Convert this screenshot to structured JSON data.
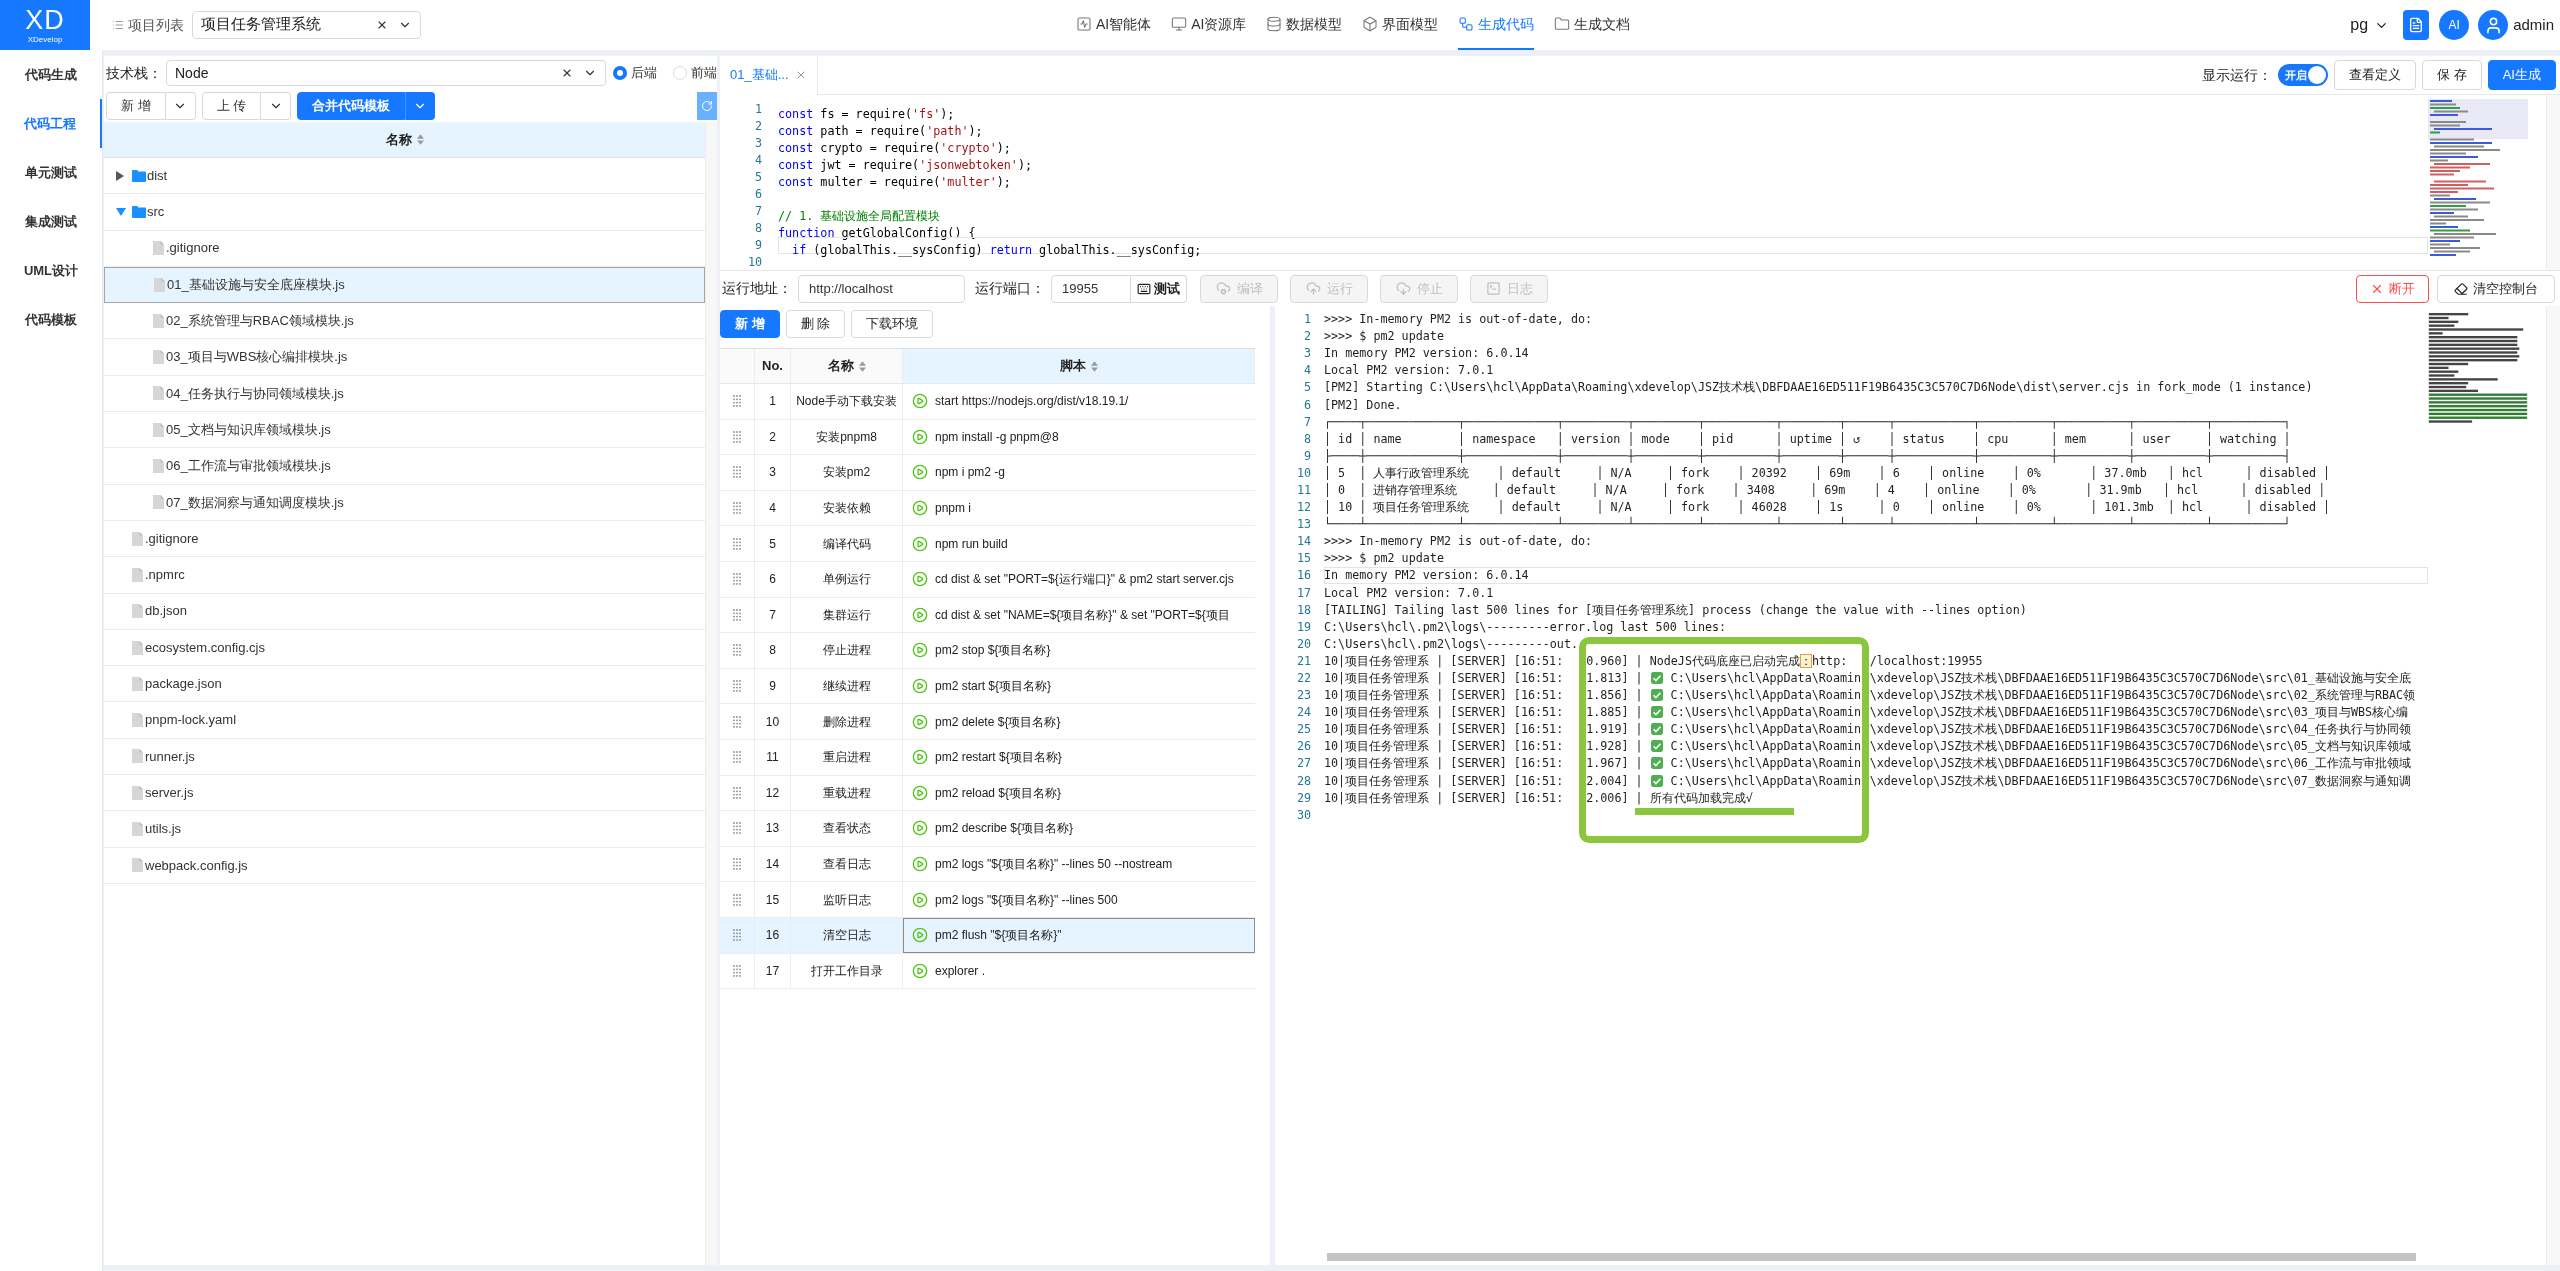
{
  "header": {
    "logo": {
      "mark": "XD",
      "name": "XDevelop"
    },
    "project_list": "项目列表",
    "project_select": {
      "value": "项目任务管理系统"
    },
    "nav": [
      {
        "label": "AI智能体",
        "selected": false
      },
      {
        "label": "AI资源库",
        "selected": false
      },
      {
        "label": "数据模型",
        "selected": false
      },
      {
        "label": "界面模型",
        "selected": false
      },
      {
        "label": "生成代码",
        "selected": true
      },
      {
        "label": "生成文档",
        "selected": false
      }
    ],
    "db_select": {
      "value": "pg"
    },
    "ai_button": "AI",
    "user": "admin"
  },
  "sidebar": {
    "items": [
      {
        "label": "代码生成",
        "selected": false
      },
      {
        "label": "代码工程",
        "selected": true
      },
      {
        "label": "单元测试",
        "selected": false
      },
      {
        "label": "集成测试",
        "selected": false
      },
      {
        "label": "UML设计",
        "selected": false
      },
      {
        "label": "代码模板",
        "selected": false
      }
    ]
  },
  "file_panel": {
    "tech_stack": {
      "label": "技术栈：",
      "value": "Node"
    },
    "side_options": [
      {
        "label": "后端",
        "selected": true
      },
      {
        "label": "前端",
        "selected": false
      }
    ],
    "buttons": [
      {
        "label": "新 增",
        "kind": "default"
      },
      {
        "label": "上 传",
        "kind": "default"
      },
      {
        "label": "合并代码模板",
        "kind": "primary"
      }
    ],
    "tree": {
      "column": {
        "label": "名称",
        "sortable": true
      },
      "items": [
        {
          "name": "dist",
          "kind": "folder",
          "expanded": false,
          "selected": false
        },
        {
          "name": "src",
          "kind": "folder",
          "expanded": true,
          "selected": false,
          "children": [
            {
              "name": ".gitignore",
              "kind": "file",
              "selected": false
            },
            {
              "name": "01_基础设施与安全底座模块.js",
              "kind": "file",
              "selected": true
            },
            {
              "name": "02_系统管理与RBAC领域模块.js",
              "kind": "file",
              "selected": false
            },
            {
              "name": "03_项目与WBS核心编排模块.js",
              "kind": "file",
              "selected": false
            },
            {
              "name": "04_任务执行与协同领域模块.js",
              "kind": "file",
              "selected": false
            },
            {
              "name": "05_文档与知识库领域模块.js",
              "kind": "file",
              "selected": false
            },
            {
              "name": "06_工作流与审批领域模块.js",
              "kind": "file",
              "selected": false
            },
            {
              "name": "07_数据洞察与通知调度模块.js",
              "kind": "file",
              "selected": false
            }
          ]
        },
        {
          "name": ".gitignore",
          "kind": "file",
          "selected": false
        },
        {
          "name": ".npmrc",
          "kind": "file",
          "selected": false
        },
        {
          "name": "db.json",
          "kind": "file",
          "selected": false
        },
        {
          "name": "ecosystem.config.cjs",
          "kind": "file",
          "selected": false
        },
        {
          "name": "package.json",
          "kind": "file",
          "selected": false
        },
        {
          "name": "pnpm-lock.yaml",
          "kind": "file",
          "selected": false
        },
        {
          "name": "runner.js",
          "kind": "file",
          "selected": false
        },
        {
          "name": "server.js",
          "kind": "file",
          "selected": false
        },
        {
          "name": "utils.js",
          "kind": "file",
          "selected": false
        },
        {
          "name": "webpack.config.js",
          "kind": "file",
          "selected": false
        }
      ]
    }
  },
  "editor": {
    "tabs": [
      {
        "label": "01_基础...",
        "selected": true
      }
    ],
    "show_run": {
      "label": "显示运行：",
      "on": true,
      "on_text": "开启"
    },
    "buttons": [
      {
        "label": "查看定义",
        "kind": "default"
      },
      {
        "label": "保 存",
        "kind": "default"
      },
      {
        "label": "AI生成",
        "kind": "primary"
      }
    ],
    "lines": [
      {
        "number": "1",
        "current": false,
        "tokens": [
          {
            "text": "const",
            "kind": "keyword"
          },
          {
            "text": " fs = require(",
            "kind": "plain"
          },
          {
            "text": "'fs'",
            "kind": "string"
          },
          {
            "text": ");",
            "kind": "plain"
          }
        ]
      },
      {
        "number": "2",
        "current": false,
        "tokens": [
          {
            "text": "const",
            "kind": "keyword"
          },
          {
            "text": " path = require(",
            "kind": "plain"
          },
          {
            "text": "'path'",
            "kind": "string"
          },
          {
            "text": ");",
            "kind": "plain"
          }
        ]
      },
      {
        "number": "3",
        "current": false,
        "tokens": [
          {
            "text": "const",
            "kind": "keyword"
          },
          {
            "text": " crypto = require(",
            "kind": "plain"
          },
          {
            "text": "'crypto'",
            "kind": "string"
          },
          {
            "text": ");",
            "kind": "plain"
          }
        ]
      },
      {
        "number": "4",
        "current": false,
        "tokens": [
          {
            "text": "const",
            "kind": "keyword"
          },
          {
            "text": " jwt = require(",
            "kind": "plain"
          },
          {
            "text": "'jsonwebtoken'",
            "kind": "string"
          },
          {
            "text": ");",
            "kind": "plain"
          }
        ]
      },
      {
        "number": "5",
        "current": false,
        "tokens": [
          {
            "text": "const",
            "kind": "keyword"
          },
          {
            "text": " multer = require(",
            "kind": "plain"
          },
          {
            "text": "'multer'",
            "kind": "string"
          },
          {
            "text": ");",
            "kind": "plain"
          }
        ]
      },
      {
        "number": "6",
        "current": false
      },
      {
        "number": "7",
        "current": false,
        "tokens": [
          {
            "text": "// 1. 基础设施全局配置模块",
            "kind": "comment"
          }
        ]
      },
      {
        "number": "8",
        "current": false,
        "tokens": [
          {
            "text": "function",
            "kind": "keyword"
          },
          {
            "text": " getGlobalConfig() {",
            "kind": "plain"
          }
        ]
      },
      {
        "number": "9",
        "current": true,
        "tokens": [
          {
            "text": "  if",
            "kind": "keyword"
          },
          {
            "text": " (globalThis.__sysConfig) ",
            "kind": "plain"
          },
          {
            "text": "return",
            "kind": "keyword"
          },
          {
            "text": " globalThis.__sysConfig;",
            "kind": "plain"
          }
        ]
      },
      {
        "number": "10",
        "current": false
      }
    ]
  },
  "run_bar": {
    "address": {
      "label": "运行地址：",
      "value": "http://localhost"
    },
    "port": {
      "label": "运行端口：",
      "value": "19955"
    },
    "test_button": "测试",
    "actions": [
      {
        "label": "编译",
        "disabled": true
      },
      {
        "label": "运行",
        "disabled": true
      },
      {
        "label": "停止",
        "disabled": true
      },
      {
        "label": "日志",
        "disabled": true
      }
    ],
    "disconnect_button": "断开",
    "clear_button": "清空控制台"
  },
  "script_table": {
    "buttons": [
      {
        "label": "新 增",
        "kind": "primary"
      },
      {
        "label": "删 除",
        "kind": "default"
      },
      {
        "label": "下载环境",
        "kind": "default"
      }
    ],
    "columns": [
      {
        "label": "No.",
        "sortable": false,
        "highlighted": false
      },
      {
        "label": "名称",
        "sortable": true,
        "highlighted": false
      },
      {
        "label": "脚本",
        "sortable": true,
        "highlighted": true
      }
    ],
    "rows": [
      {
        "no": "1",
        "name": "Node手动下载安装",
        "script": "start https://nodejs.org/dist/v18.19.1/",
        "selected": false
      },
      {
        "no": "2",
        "name": "安装pnpm8",
        "script": "npm install -g pnpm@8",
        "selected": false
      },
      {
        "no": "3",
        "name": "安装pm2",
        "script": "npm i pm2 -g",
        "selected": false
      },
      {
        "no": "4",
        "name": "安装依赖",
        "script": "pnpm i",
        "selected": false
      },
      {
        "no": "5",
        "name": "编译代码",
        "script": "npm run build",
        "selected": false
      },
      {
        "no": "6",
        "name": "单例运行",
        "script": "cd dist & set \"PORT=${运行端口}\" & pm2 start server.cjs",
        "selected": false
      },
      {
        "no": "7",
        "name": "集群运行",
        "script": "cd dist & set \"NAME=${项目名称}\" & set \"PORT=${项目",
        "selected": false
      },
      {
        "no": "8",
        "name": "停止进程",
        "script": "pm2 stop ${项目名称}",
        "selected": false
      },
      {
        "no": "9",
        "name": "继续进程",
        "script": "pm2 start ${项目名称}",
        "selected": false
      },
      {
        "no": "10",
        "name": "删除进程",
        "script": "pm2 delete ${项目名称}",
        "selected": false
      },
      {
        "no": "11",
        "name": "重启进程",
        "script": "pm2 restart ${项目名称}",
        "selected": false
      },
      {
        "no": "12",
        "name": "重载进程",
        "script": "pm2 reload ${项目名称}",
        "selected": false
      },
      {
        "no": "13",
        "name": "查看状态",
        "script": "pm2 describe ${项目名称}",
        "selected": false
      },
      {
        "no": "14",
        "name": "查看日志",
        "script": "pm2 logs \"${项目名称}\" --lines 50 --nostream",
        "selected": false
      },
      {
        "no": "15",
        "name": "监听日志",
        "script": "pm2 logs \"${项目名称}\" --lines 500",
        "selected": false
      },
      {
        "no": "16",
        "name": "清空日志",
        "script": "pm2 flush \"${项目名称}\"",
        "selected": true
      },
      {
        "no": "17",
        "name": "打开工作目录",
        "script": "explorer .",
        "selected": false
      }
    ]
  },
  "console": {
    "lines": [
      {
        "number": "1",
        "kind": "text",
        "current": false,
        "text": ">>>> In-memory PM2 is out-of-date, do:"
      },
      {
        "number": "2",
        "kind": "text",
        "current": false,
        "text": ">>>> $ pm2 update"
      },
      {
        "number": "3",
        "kind": "text",
        "current": false,
        "text": "In memory PM2 version: 6.0.14"
      },
      {
        "number": "4",
        "kind": "text",
        "current": false,
        "text": "Local PM2 version: 7.0.1"
      },
      {
        "number": "5",
        "kind": "text",
        "current": false,
        "text": "[PM2] Starting C:\\Users\\hcl\\AppData\\Roaming\\xdevelop\\JSZ技术栈\\DBFDAAE16ED511F19B6435C3C570C7D6Node\\dist\\server.cjs in fork_mode (1 instance)"
      },
      {
        "number": "6",
        "kind": "text",
        "current": false,
        "text": "[PM2] Done."
      },
      {
        "number": "7",
        "kind": "text",
        "current": false,
        "text": "┌────┬─────────────┬─────────────┬─────────┬─────────┬──────────┬────────┬──────┬───────────┬──────────┬──────────┬──────────┬──────────┐"
      },
      {
        "number": "8",
        "kind": "text",
        "current": false,
        "text": "│ id │ name        │ namespace   │ version │ mode    │ pid      │ uptime │ ↺    │ status    │ cpu      │ mem      │ user     │ watching │"
      },
      {
        "number": "9",
        "kind": "text",
        "current": false,
        "text": "├────┼─────────────┼─────────────┼─────────┼─────────┼──────────┼────────┼──────┼───────────┼──────────┼──────────┼──────────┼──────────┤"
      },
      {
        "number": "10",
        "kind": "text",
        "current": false,
        "text": "│ 5  │ 人事行政管理系统    │ default     │ N/A     │ fork    │ 20392    │ 69m    │ 6    │ online    │ 0%       │ 37.0mb   │ hcl      │ disabled │"
      },
      {
        "number": "11",
        "kind": "text",
        "current": false,
        "text": "│ 0  │ 进销存管理系统     │ default     │ N/A     │ fork    │ 3408     │ 69m    │ 4    │ online    │ 0%       │ 31.9mb   │ hcl      │ disabled │"
      },
      {
        "number": "12",
        "kind": "text",
        "current": false,
        "text": "│ 10 │ 项目任务管理系统    │ default     │ N/A     │ fork    │ 46028    │ 1s     │ 0    │ online    │ 0%       │ 101.3mb  │ hcl      │ disabled │"
      },
      {
        "number": "13",
        "kind": "text",
        "current": false,
        "text": "└────┴─────────────┴─────────────┴─────────┴─────────┴──────────┴────────┴──────┴───────────┴──────────┴──────────┴──────────┴──────────┘"
      },
      {
        "number": "14",
        "kind": "text",
        "current": false,
        "text": ">>>> In-memory PM2 is out-of-date, do:"
      },
      {
        "number": "15",
        "kind": "text",
        "current": false,
        "text": ">>>> $ pm2 update"
      },
      {
        "number": "16",
        "kind": "text",
        "current": true,
        "text": "In memory PM2 version: 6.0.14"
      },
      {
        "number": "17",
        "kind": "text",
        "current": false,
        "text": "Local PM2 version: 7.0.1"
      },
      {
        "number": "18",
        "kind": "text",
        "current": false,
        "text": "[TAILING] Tailing last 500 lines for [项目任务管理系统] process (change the value with --lines option)"
      },
      {
        "number": "19",
        "kind": "text",
        "current": false,
        "text": "C:\\Users\\hcl\\.pm2\\logs\\---------error.log last 500 lines:"
      },
      {
        "number": "20",
        "kind": "text",
        "current": false,
        "text": "C:\\Users\\hcl\\.pm2\\logs\\---------out."
      },
      {
        "number": "21",
        "kind": "split",
        "current": false,
        "parts": [
          {
            "kind": "text",
            "text": "10|项目任务管理系 | [SERVER] [16:51:"
          },
          {
            "kind": "mark",
            "text": "0.960] | NodeJS代码底座已启动完成",
            "mark": "：",
            "after": "http:"
          },
          {
            "kind": "text",
            "text": "/localhost:19955"
          }
        ]
      },
      {
        "number": "22",
        "kind": "split",
        "current": false,
        "parts": [
          {
            "kind": "text",
            "text": "10|项目任务管理系 | [SERVER] [16:51:"
          },
          {
            "kind": "check",
            "text": "1.813] |",
            "after": "C:\\Users\\hcl\\AppData\\Roamin"
          },
          {
            "kind": "text",
            "text": "\\xdevelop\\JSZ技术栈\\DBFDAAE16ED511F19B6435C3C570C7D6Node\\src\\01_基础设施与安全底"
          }
        ]
      },
      {
        "number": "23",
        "kind": "split",
        "current": false,
        "parts": [
          {
            "kind": "text",
            "text": "10|项目任务管理系 | [SERVER] [16:51:"
          },
          {
            "kind": "check",
            "text": "1.856] |",
            "after": "C:\\Users\\hcl\\AppData\\Roamin"
          },
          {
            "kind": "text",
            "text": "\\xdevelop\\JSZ技术栈\\DBFDAAE16ED511F19B6435C3C570C7D6Node\\src\\02_系统管理与RBAC领"
          }
        ]
      },
      {
        "number": "24",
        "kind": "split",
        "current": false,
        "parts": [
          {
            "kind": "text",
            "text": "10|项目任务管理系 | [SERVER] [16:51:"
          },
          {
            "kind": "check",
            "text": "1.885] |",
            "after": "C:\\Users\\hcl\\AppData\\Roamin"
          },
          {
            "kind": "text",
            "text": "\\xdevelop\\JSZ技术栈\\DBFDAAE16ED511F19B6435C3C570C7D6Node\\src\\03_项目与WBS核心编"
          }
        ]
      },
      {
        "number": "25",
        "kind": "split",
        "current": false,
        "parts": [
          {
            "kind": "text",
            "text": "10|项目任务管理系 | [SERVER] [16:51:"
          },
          {
            "kind": "check",
            "text": "1.919] |",
            "after": "C:\\Users\\hcl\\AppData\\Roamin"
          },
          {
            "kind": "text",
            "text": "\\xdevelop\\JSZ技术栈\\DBFDAAE16ED511F19B6435C3C570C7D6Node\\src\\04_任务执行与协同领"
          }
        ]
      },
      {
        "number": "26",
        "kind": "split",
        "current": false,
        "parts": [
          {
            "kind": "text",
            "text": "10|项目任务管理系 | [SERVER] [16:51:"
          },
          {
            "kind": "check",
            "text": "1.928] |",
            "after": "C:\\Users\\hcl\\AppData\\Roamin"
          },
          {
            "kind": "text",
            "text": "\\xdevelop\\JSZ技术栈\\DBFDAAE16ED511F19B6435C3C570C7D6Node\\src\\05_文档与知识库领域"
          }
        ]
      },
      {
        "number": "27",
        "kind": "split",
        "current": false,
        "parts": [
          {
            "kind": "text",
            "text": "10|项目任务管理系 | [SERVER] [16:51:"
          },
          {
            "kind": "check",
            "text": "1.967] |",
            "after": "C:\\Users\\hcl\\AppData\\Roamin"
          },
          {
            "kind": "text",
            "text": "\\xdevelop\\JSZ技术栈\\DBFDAAE16ED511F19B6435C3C570C7D6Node\\src\\06_工作流与审批领域"
          }
        ]
      },
      {
        "number": "28",
        "kind": "split",
        "current": false,
        "parts": [
          {
            "kind": "text",
            "text": "10|项目任务管理系 | [SERVER] [16:51:"
          },
          {
            "kind": "check",
            "text": "2.004] |",
            "after": "C:\\Users\\hcl\\AppData\\Roamin"
          },
          {
            "kind": "text",
            "text": "\\xdevelop\\JSZ技术栈\\DBFDAAE16ED511F19B6435C3C570C7D6Node\\src\\07_数据洞察与通知调"
          }
        ]
      },
      {
        "number": "29",
        "kind": "split",
        "current": false,
        "parts": [
          {
            "kind": "text",
            "text": "10|项目任务管理系 | [SERVER] [16:51:"
          },
          {
            "kind": "text",
            "text": "2.006] | 所有代码加载完成√"
          }
        ]
      },
      {
        "number": "30",
        "kind": "text",
        "current": false
      }
    ]
  }
}
